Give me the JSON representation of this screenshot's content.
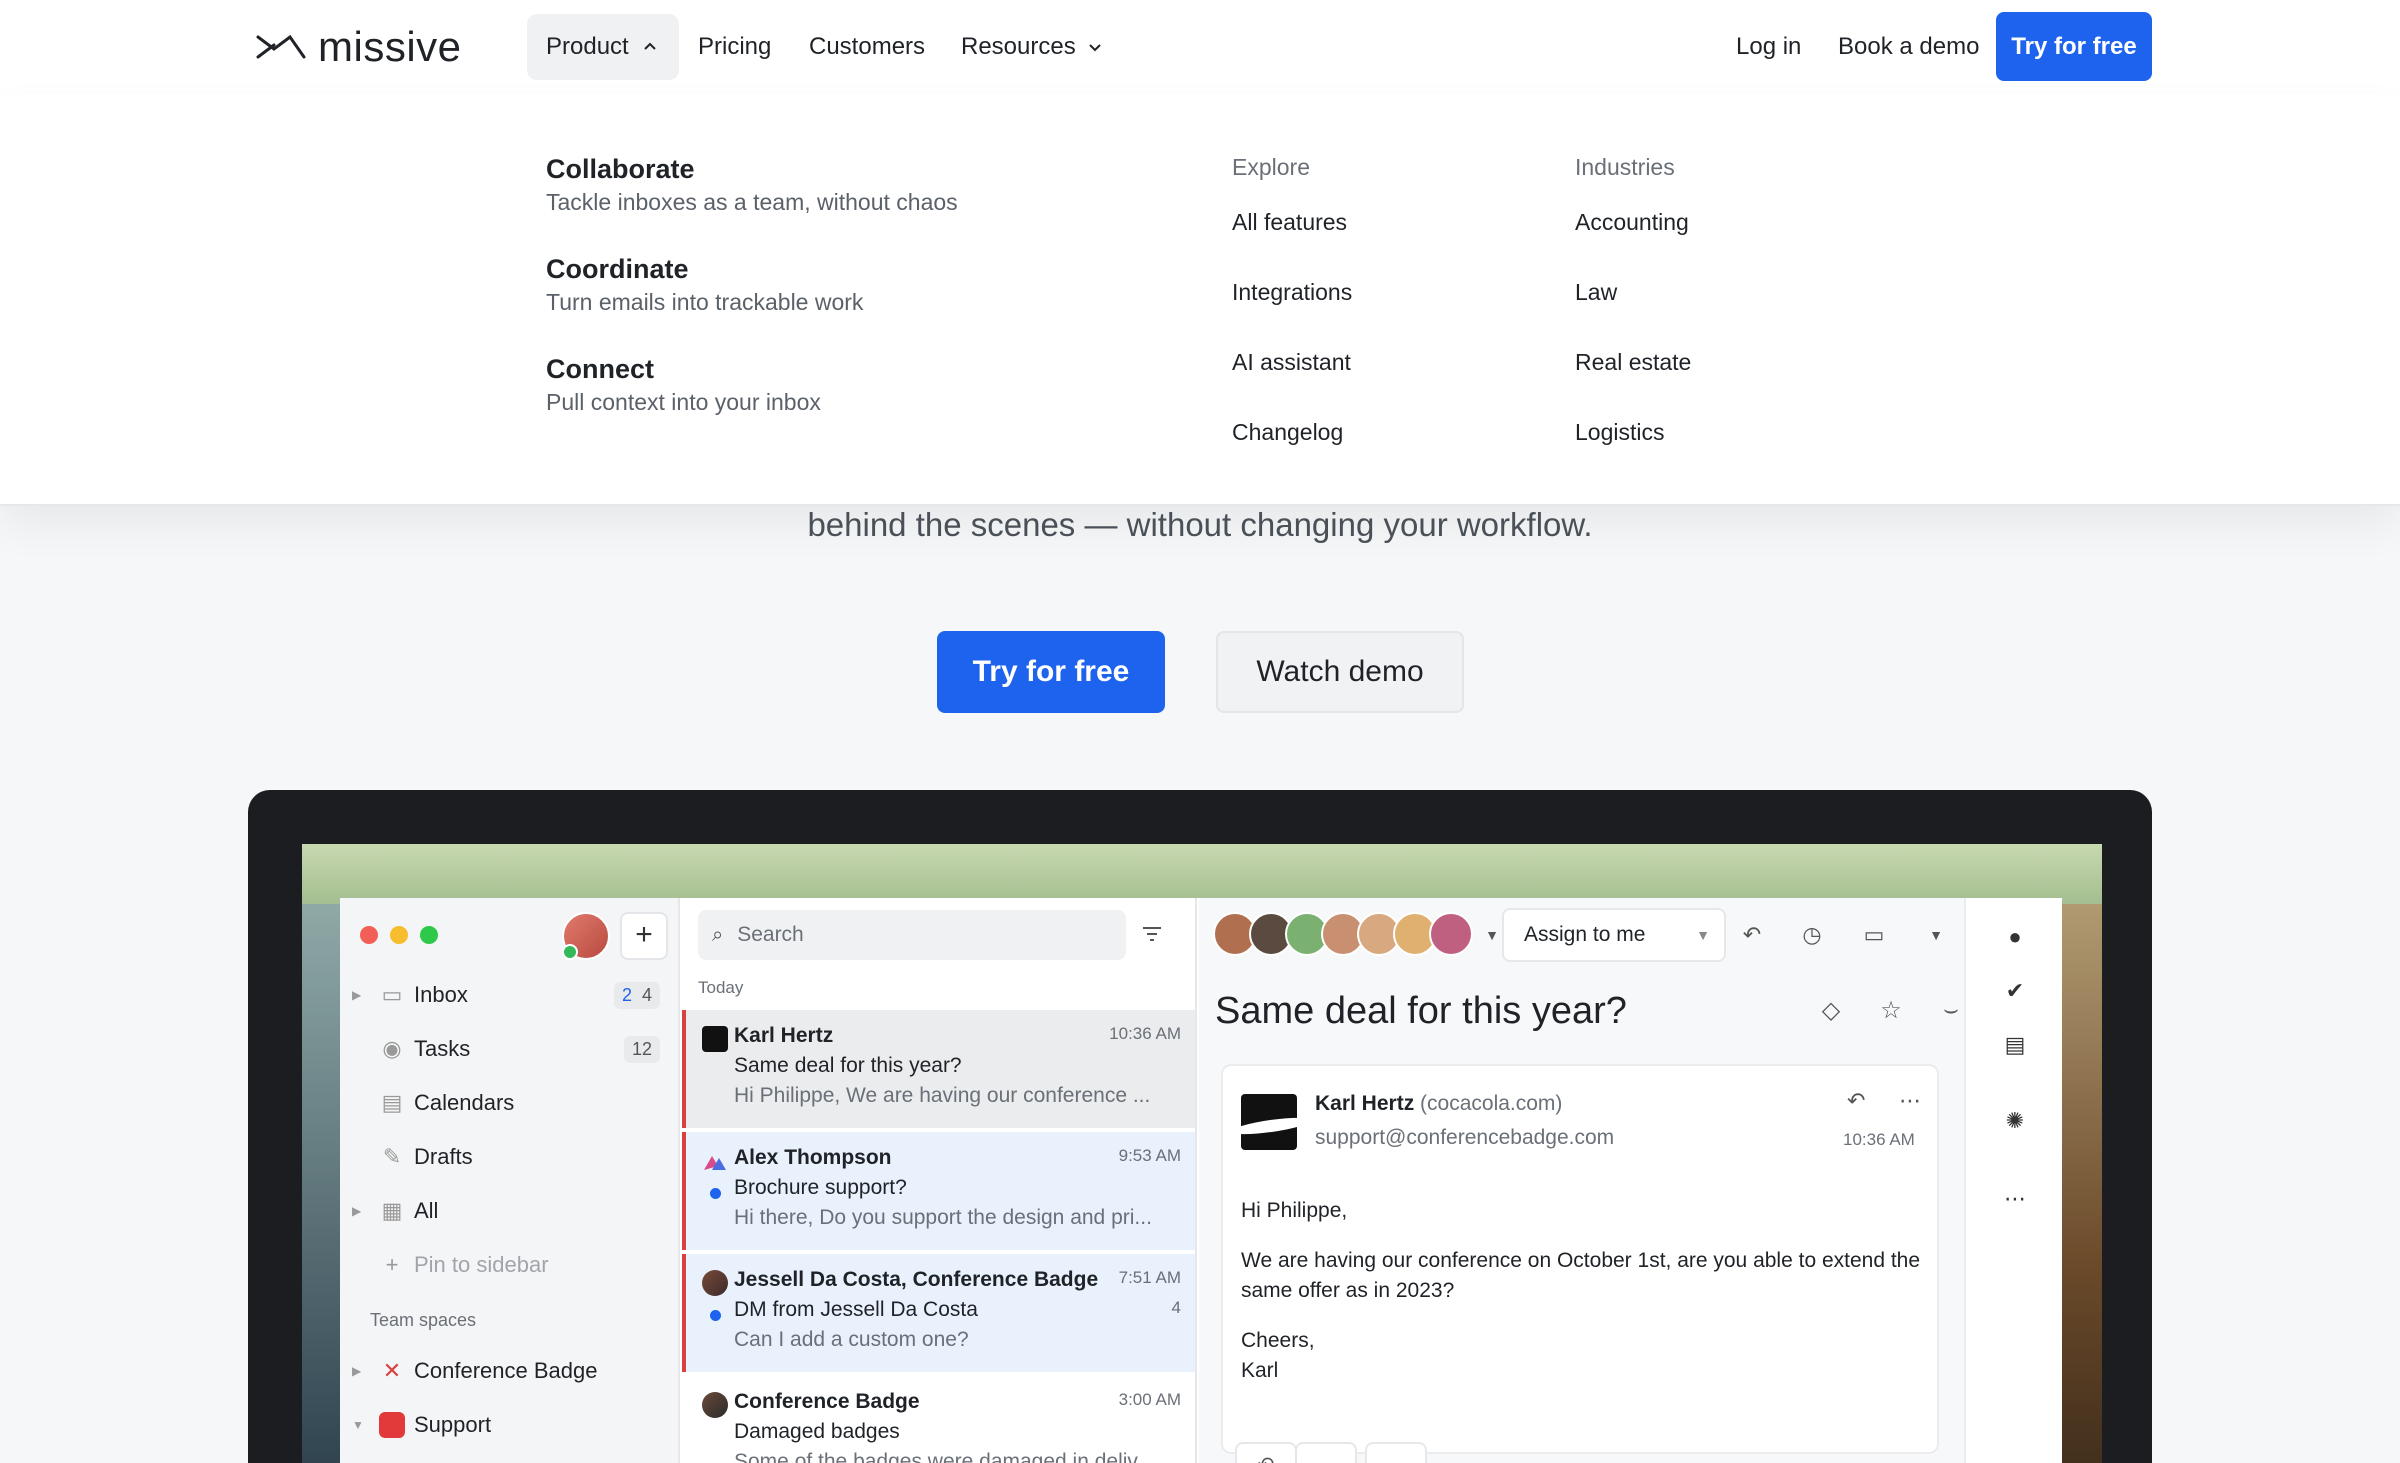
{
  "nav": {
    "logo_text": "missive",
    "product": "Product",
    "pricing": "Pricing",
    "customers": "Customers",
    "resources": "Resources",
    "login": "Log in",
    "book_demo": "Book a demo",
    "try_free": "Try for free"
  },
  "dropdown": {
    "items": [
      {
        "title": "Collaborate",
        "subtitle": "Tackle inboxes as a team, without chaos"
      },
      {
        "title": "Coordinate",
        "subtitle": "Turn emails into trackable work"
      },
      {
        "title": "Connect",
        "subtitle": "Pull context into your inbox"
      }
    ],
    "explore": {
      "heading": "Explore",
      "links": [
        "All features",
        "Integrations",
        "AI assistant",
        "Changelog"
      ]
    },
    "industries": {
      "heading": "Industries",
      "links": [
        "Accounting",
        "Law",
        "Real estate",
        "Logistics"
      ]
    }
  },
  "hero": {
    "subtitle": "behind the scenes — without changing your workflow.",
    "try_free": "Try for free",
    "watch_demo": "Watch demo"
  },
  "app": {
    "sidebar": {
      "items": [
        {
          "label": "Inbox",
          "count_a": "2",
          "count_b": "4"
        },
        {
          "label": "Tasks",
          "count": "12"
        },
        {
          "label": "Calendars"
        },
        {
          "label": "Drafts"
        },
        {
          "label": "All"
        },
        {
          "label": "Pin to sidebar"
        }
      ],
      "section_label": "Team spaces",
      "team_spaces": [
        "Conference Badge",
        "Support"
      ]
    },
    "list": {
      "search_placeholder": "Search",
      "day_label": "Today",
      "messages": [
        {
          "from": "Karl Hertz",
          "time": "10:36 AM",
          "subject": "Same deal for this year?",
          "preview": "Hi Philippe, We are having our conference ..."
        },
        {
          "from": "Alex Thompson",
          "time": "9:53 AM",
          "subject": "Brochure support?",
          "preview": "Hi there, Do you support the design and pri..."
        },
        {
          "from": "Jessell Da Costa, Conference Badge",
          "time": "7:51 AM",
          "subject": "DM from Jessell Da Costa",
          "count": "4",
          "preview": "Can I add a custom one?"
        },
        {
          "from": "Conference Badge",
          "time": "3:00 AM",
          "subject": "Damaged badges",
          "preview": "Some of the badges were damaged in deliv..."
        }
      ]
    },
    "reader": {
      "assign_label": "Assign to me",
      "subject": "Same deal for this year?",
      "sender_name": "Karl Hertz",
      "sender_domain": "(cocacola.com)",
      "sender_address": "support@conferencebadge.com",
      "time": "10:36 AM",
      "body": [
        "Hi Philippe,",
        "We are having our conference on October 1st, are you able to extend the same offer as in 2023?",
        "Cheers,",
        "Karl"
      ]
    }
  },
  "colors": {
    "brand_blue": "#1d63ed",
    "unread_dot": "#1d63ed",
    "priority_bar": "#d94040"
  }
}
